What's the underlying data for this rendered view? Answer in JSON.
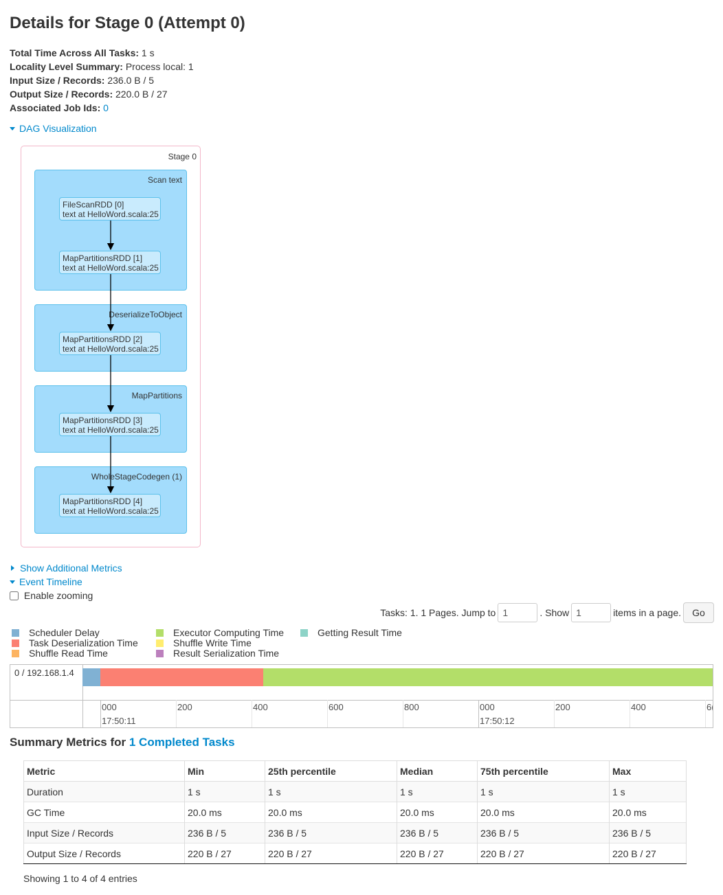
{
  "page": {
    "title": "Details for Stage 0 (Attempt 0)"
  },
  "summary": {
    "total_time_label": "Total Time Across All Tasks:",
    "total_time_value": "1 s",
    "locality_label": "Locality Level Summary:",
    "locality_value": "Process local: 1",
    "input_label": "Input Size / Records:",
    "input_value": "236.0 B / 5",
    "output_label": "Output Size / Records:",
    "output_value": "220.0 B / 27",
    "job_ids_label": "Associated Job Ids:",
    "job_ids_value": "0"
  },
  "dag": {
    "toggle_label": "DAG Visualization",
    "stage_label": "Stage 0",
    "clusters": [
      {
        "label": "Scan text"
      },
      {
        "label": "DeserializeToObject"
      },
      {
        "label": "MapPartitions"
      },
      {
        "label": "WholeStageCodegen (1)"
      }
    ],
    "nodes": [
      {
        "line1": "FileScanRDD [0]",
        "line2": "text at HelloWord.scala:25"
      },
      {
        "line1": "MapPartitionsRDD [1]",
        "line2": "text at HelloWord.scala:25"
      },
      {
        "line1": "MapPartitionsRDD [2]",
        "line2": "text at HelloWord.scala:25"
      },
      {
        "line1": "MapPartitionsRDD [3]",
        "line2": "text at HelloWord.scala:25"
      },
      {
        "line1": "MapPartitionsRDD [4]",
        "line2": "text at HelloWord.scala:25"
      }
    ]
  },
  "additional_metrics_label": "Show Additional Metrics",
  "event_timeline_label": "Event Timeline",
  "enable_zooming_label": "Enable zooming",
  "enable_zooming_checked": false,
  "paging": {
    "prefix": "Tasks: 1. 1 Pages. Jump to",
    "jump_value": "1",
    "show_label": ". Show",
    "show_value": "1",
    "suffix": "items in a page.",
    "go_label": "Go"
  },
  "legend": [
    {
      "label": "Scheduler Delay",
      "color": "#80b1d3"
    },
    {
      "label": "Task Deserialization Time",
      "color": "#fb8072"
    },
    {
      "label": "Shuffle Read Time",
      "color": "#fdb462"
    },
    {
      "label": "Executor Computing Time",
      "color": "#b3de69"
    },
    {
      "label": "Shuffle Write Time",
      "color": "#ffed6f"
    },
    {
      "label": "Result Serialization Time",
      "color": "#bc80bd"
    },
    {
      "label": "Getting Result Time",
      "color": "#8dd3c7"
    }
  ],
  "timeline": {
    "executor": "0 / 192.168.1.4",
    "tick_labels": [
      "000",
      "200",
      "400",
      "600",
      "800",
      "000",
      "200",
      "400",
      "6("
    ],
    "time_labels": [
      "17:50:11",
      "17:50:12"
    ]
  },
  "summary_metrics": {
    "title_prefix": "Summary Metrics for",
    "title_link": "1 Completed Tasks",
    "columns": [
      "Metric",
      "Min",
      "25th percentile",
      "Median",
      "75th percentile",
      "Max"
    ],
    "rows": [
      [
        "Duration",
        "1 s",
        "1 s",
        "1 s",
        "1 s",
        "1 s"
      ],
      [
        "GC Time",
        "20.0 ms",
        "20.0 ms",
        "20.0 ms",
        "20.0 ms",
        "20.0 ms"
      ],
      [
        "Input Size / Records",
        "236 B / 5",
        "236 B / 5",
        "236 B / 5",
        "236 B / 5",
        "236 B / 5"
      ],
      [
        "Output Size / Records",
        "220 B / 27",
        "220 B / 27",
        "220 B / 27",
        "220 B / 27",
        "220 B / 27"
      ]
    ],
    "showing": "Showing 1 to 4 of 4 entries"
  }
}
